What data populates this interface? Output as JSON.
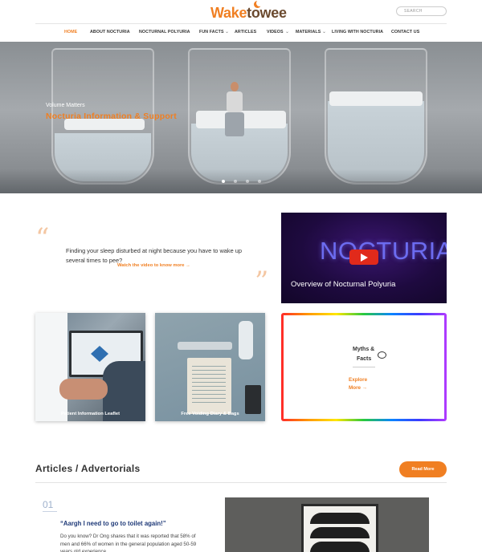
{
  "header": {
    "logo": {
      "part1": "Wake",
      "part2": "to",
      "part3": "wee"
    },
    "search_placeholder": "SEARCH"
  },
  "nav": {
    "items": [
      {
        "label": "HOME",
        "active": true,
        "has_dropdown": false
      },
      {
        "label": "ABOUT NOCTURIA",
        "active": false,
        "has_dropdown": false
      },
      {
        "label": "NOCTURNAL POLYURIA",
        "active": false,
        "has_dropdown": false
      },
      {
        "label": "FUN FACTS",
        "active": false,
        "has_dropdown": true
      },
      {
        "label": "ARTICLES",
        "active": false,
        "has_dropdown": false
      },
      {
        "label": "VIDEOS",
        "active": false,
        "has_dropdown": true
      },
      {
        "label": "MATERIALS",
        "active": false,
        "has_dropdown": true
      },
      {
        "label": "LIVING WITH NOCTURIA",
        "active": false,
        "has_dropdown": false
      },
      {
        "label": "CONTACT US",
        "active": false,
        "has_dropdown": false
      }
    ],
    "dropdown_icon": "chevron-down-icon"
  },
  "hero": {
    "subtitle": "Volume Matters",
    "title": "Nocturia Information & Support",
    "slides": 4,
    "active_slide": 1
  },
  "intro": {
    "text": "Finding your sleep disturbed at night because you have to wake up several times to pee?",
    "link": "Watch the video to know more →"
  },
  "video": {
    "banner_text": "NOCTURIA",
    "caption": "Overview of Nocturnal Polyuria",
    "icon": "play-icon"
  },
  "cards": [
    {
      "caption": "Patient Information Leaflet"
    },
    {
      "caption": "Free Voiding Diary & Bags"
    }
  ],
  "myths_card": {
    "title_line1": "Myths &",
    "title_line2": "Facts",
    "icon": "chat-bubble-icon",
    "link_line1": "Explore",
    "link_line2": "More →"
  },
  "articles": {
    "heading": "Articles / Advertorials",
    "read_more": "Read More",
    "first": {
      "number": "01",
      "title": "“Aargh I need to go to toilet again!”",
      "body": "Do you know? Dr Ong shares that it was reported that 58% of men and 66% of women in the general population aged 50-59 years old experience"
    }
  },
  "colors": {
    "accent": "#f07f22",
    "brand_brown": "#6b4a2f",
    "article_title": "#1f3a78"
  }
}
